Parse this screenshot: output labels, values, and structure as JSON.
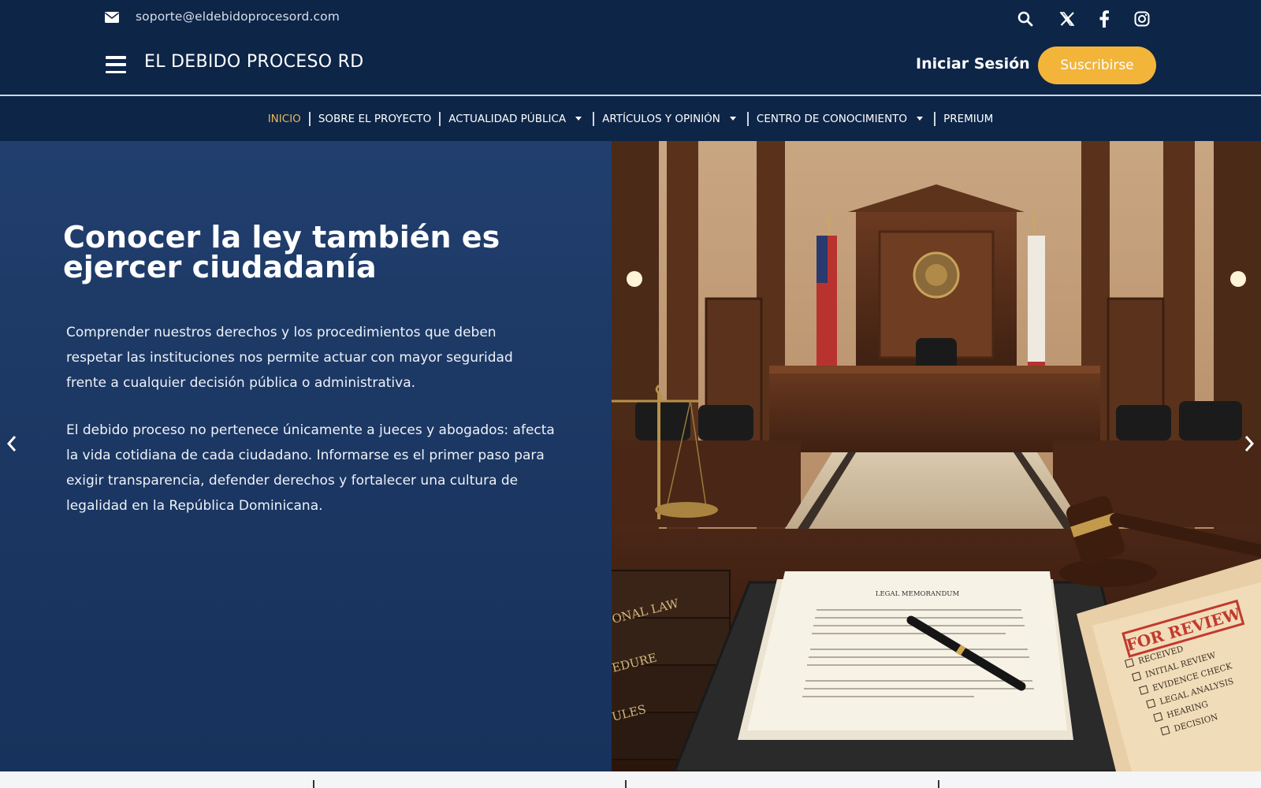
{
  "topbar": {
    "email": "soporte@eldebidoprocesord.com",
    "site_title": "EL DEBIDO PROCESO RD",
    "login_label": "Iniciar Sesión",
    "subscribe_label": "Suscribirse",
    "icons": [
      "envelope-icon",
      "search-icon",
      "x-twitter-icon",
      "facebook-icon",
      "instagram-icon",
      "hamburger-menu-icon"
    ]
  },
  "nav": {
    "items": [
      {
        "label": "INICIO",
        "active": true,
        "dropdown": false
      },
      {
        "label": "SOBRE EL PROYECTO",
        "active": false,
        "dropdown": false
      },
      {
        "label": "ACTUALIDAD PÚBLICA",
        "active": false,
        "dropdown": true
      },
      {
        "label": "ARTÍCULOS Y OPINIÓN",
        "active": false,
        "dropdown": true
      },
      {
        "label": "CENTRO DE CONOCIMIENTO",
        "active": false,
        "dropdown": true
      },
      {
        "label": "PREMIUM",
        "active": false,
        "dropdown": false
      }
    ]
  },
  "hero": {
    "title": "Conocer la ley también es ejercer ciudadanía",
    "paragraph_1": "Comprender nuestros derechos y los procedimientos que deben respetar las instituciones nos permite actuar con mayor seguridad frente a cualquier decisión pública o administrativa.",
    "paragraph_2": "El debido proceso no pertenece únicamente a jueces y abogados: afecta la vida cotidiana de cada ciudadano. Informarse es el primer paso para exigir transparencia, defender derechos y fortalecer una cultura de legalidad en la República Dominicana.",
    "image": {
      "memo_title": "LEGAL MEMORANDUM",
      "stamp": "FOR REVIEW",
      "checklist": [
        "RECEIVED",
        "INITIAL REVIEW",
        "EVIDENCE CHECK",
        "LEGAL ANALYSIS",
        "HEARING",
        "DECISION"
      ],
      "book_spines": [
        "ONAL LAW",
        "EDURE",
        "ULES"
      ]
    }
  },
  "colors": {
    "header_bg": "#0d2547",
    "hero_bg": "#1c3864",
    "accent": "#f2b53a",
    "active_nav": "#e8b75c"
  }
}
